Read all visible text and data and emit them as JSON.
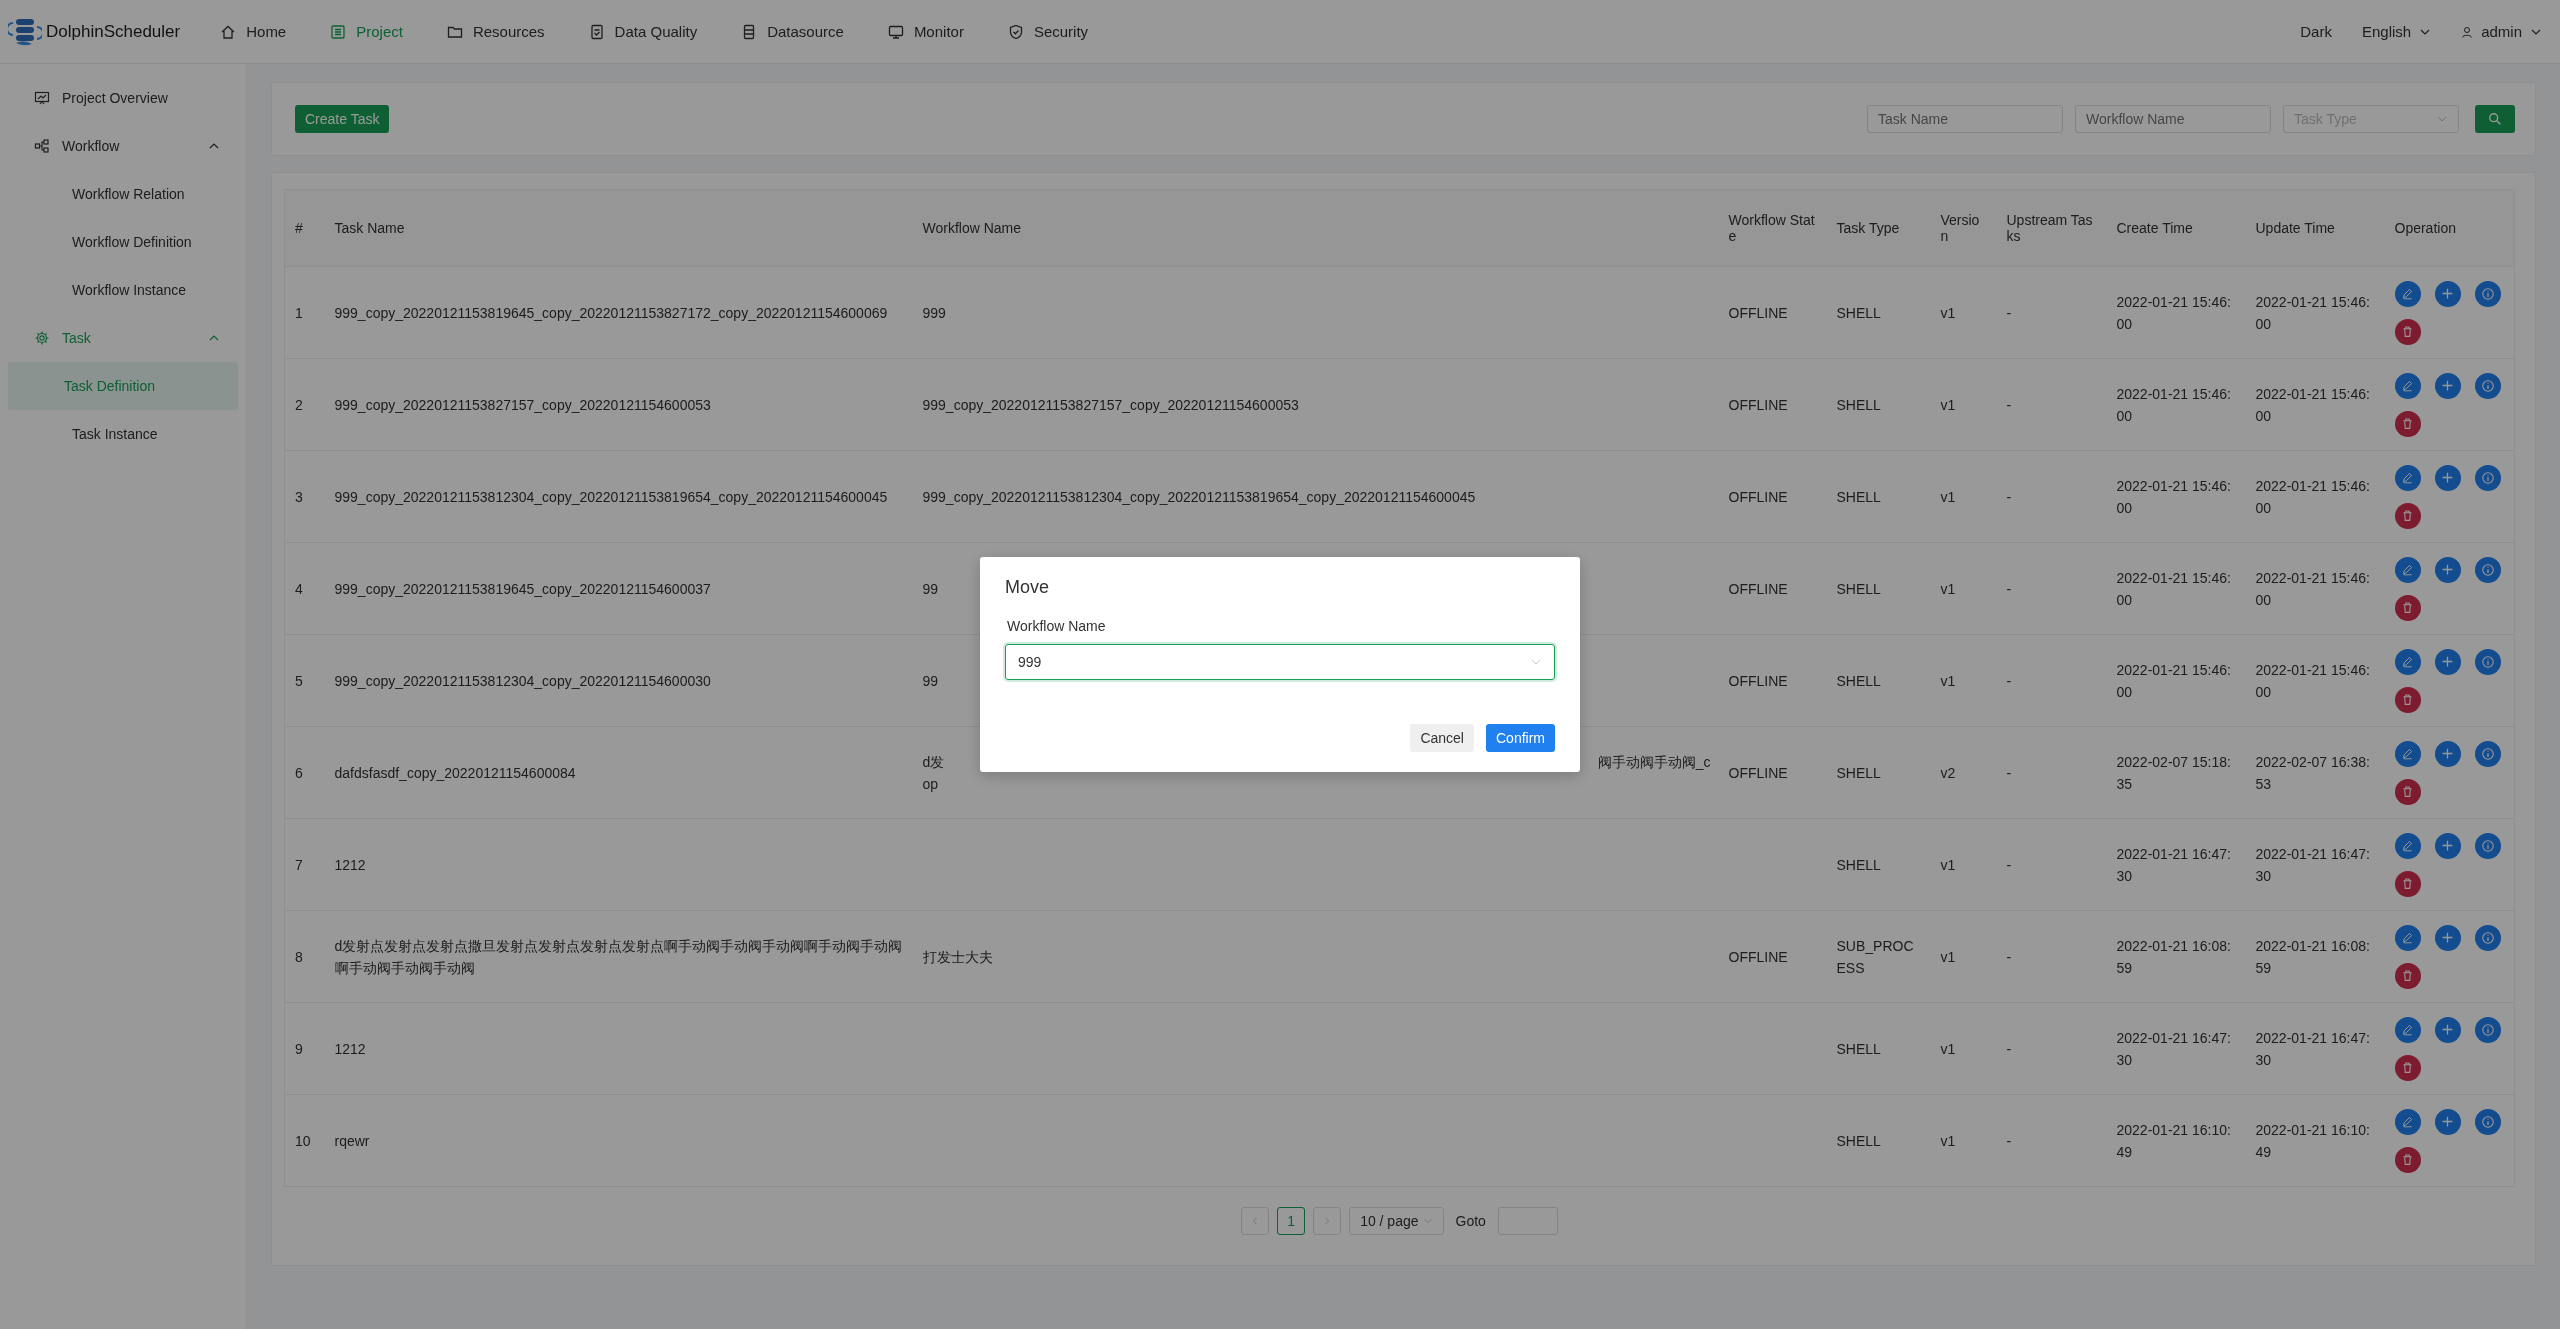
{
  "header": {
    "logo": "DolphinScheduler",
    "nav": [
      {
        "label": "Home",
        "kind": "home",
        "selected": false
      },
      {
        "label": "Project",
        "kind": "project",
        "selected": true
      },
      {
        "label": "Resources",
        "kind": "folder",
        "selected": false
      },
      {
        "label": "Data Quality",
        "kind": "quality",
        "selected": false
      },
      {
        "label": "Datasource",
        "kind": "datasource",
        "selected": false
      },
      {
        "label": "Monitor",
        "kind": "monitor",
        "selected": false
      },
      {
        "label": "Security",
        "kind": "shield",
        "selected": false
      }
    ],
    "theme": "Dark",
    "language": "English",
    "user": "admin"
  },
  "sidebar": {
    "items": [
      {
        "label": "Project Overview",
        "kind": "overview",
        "selected": false
      },
      {
        "label": "Workflow",
        "kind": "workflow",
        "expanded": true,
        "selected": false,
        "children": [
          {
            "label": "Workflow Relation",
            "selected": false
          },
          {
            "label": "Workflow Definition",
            "selected": false
          },
          {
            "label": "Workflow Instance",
            "selected": false
          }
        ]
      },
      {
        "label": "Task",
        "kind": "gear",
        "expanded": true,
        "selected": true,
        "children": [
          {
            "label": "Task Definition",
            "selected": true
          },
          {
            "label": "Task Instance",
            "selected": false
          }
        ]
      }
    ]
  },
  "toolbar": {
    "create_button": "Create Task",
    "filters": [
      {
        "kind": "input",
        "placeholder": "Task Name"
      },
      {
        "kind": "input",
        "placeholder": "Workflow Name"
      },
      {
        "kind": "select",
        "placeholder": "Task Type"
      }
    ]
  },
  "table": {
    "columns": [
      "#",
      "Task Name",
      "Workflow Name",
      "Workflow State",
      "Task Type",
      "Version",
      "Upstream Tasks",
      "Create Time",
      "Update Time",
      "Operation"
    ],
    "rows": [
      {
        "index": "1",
        "task_name": "999_copy_20220121153819645_copy_20220121153827172_copy_20220121154600069",
        "workflow_name": "999",
        "state": "OFFLINE",
        "task_type": "SHELL",
        "version": "v1",
        "upstream": "-",
        "create_time": "2022-01-21 15:46:00",
        "update_time": "2022-01-21 15:46:00"
      },
      {
        "index": "2",
        "task_name": "999_copy_20220121153827157_copy_20220121154600053",
        "workflow_name": "999_copy_20220121153827157_copy_20220121154600053",
        "state": "OFFLINE",
        "task_type": "SHELL",
        "version": "v1",
        "upstream": "-",
        "create_time": "2022-01-21 15:46:00",
        "update_time": "2022-01-21 15:46:00"
      },
      {
        "index": "3",
        "task_name": "999_copy_20220121153812304_copy_20220121153819654_copy_20220121154600045",
        "workflow_name": "999_copy_20220121153812304_copy_20220121153819654_copy_20220121154600045",
        "state": "OFFLINE",
        "task_type": "SHELL",
        "version": "v1",
        "upstream": "-",
        "create_time": "2022-01-21 15:46:00",
        "update_time": "2022-01-21 15:46:00"
      },
      {
        "index": "4",
        "task_name": "999_copy_20220121153819645_copy_20220121154600037",
        "workflow_name": "99",
        "state": "OFFLINE",
        "task_type": "SHELL",
        "version": "v1",
        "upstream": "-",
        "create_time": "2022-01-21 15:46:00",
        "update_time": "2022-01-21 15:46:00"
      },
      {
        "index": "5",
        "task_name": "999_copy_20220121153812304_copy_20220121154600030",
        "workflow_name": "99",
        "state": "OFFLINE",
        "task_type": "SHELL",
        "version": "v1",
        "upstream": "-",
        "create_time": "2022-01-21 15:46:00",
        "update_time": "2022-01-21 15:46:00"
      },
      {
        "index": "6",
        "task_name": "dafdsfasdf_copy_20220121154600084",
        "workflow_name_parts": {
          "start": [
            "d发",
            "op"
          ],
          "end": "阀手动阀手动阀_c"
        },
        "state": "OFFLINE",
        "task_type": "SHELL",
        "version": "v2",
        "upstream": "-",
        "create_time": "2022-02-07 15:18:35",
        "update_time": "2022-02-07 16:38:53"
      },
      {
        "index": "7",
        "task_name": "1212",
        "task_type": "SHELL",
        "version": "v1",
        "upstream": "-",
        "create_time": "2022-01-21 16:47:30",
        "update_time": "2022-01-21 16:47:30"
      },
      {
        "index": "8",
        "task_name": "d发射点发射点发射点撒旦发射点发射点发射点发射点啊手动阀手动阀手动阀啊手动阀手动阀啊手动阀手动阀手动阀",
        "workflow_name": "打发士大夫",
        "state": "OFFLINE",
        "task_type": "SUB_PROCESS",
        "version": "v1",
        "upstream": "-",
        "create_time": "2022-01-21 16:08:59",
        "update_time": "2022-01-21 16:08:59"
      },
      {
        "index": "9",
        "task_name": "1212",
        "task_type": "SHELL",
        "version": "v1",
        "upstream": "-",
        "create_time": "2022-01-21 16:47:30",
        "update_time": "2022-01-21 16:47:30"
      },
      {
        "index": "10",
        "task_name": "rqewr",
        "task_type": "SHELL",
        "version": "v1",
        "upstream": "-",
        "create_time": "2022-01-21 16:10:49",
        "update_time": "2022-01-21 16:10:49"
      }
    ]
  },
  "pagination": {
    "pages": [
      {
        "label": "1",
        "selected": true
      }
    ],
    "page_size": "10 / page",
    "goto_label": "Goto"
  },
  "modal": {
    "title": "Move",
    "field_label": "Workflow Name",
    "field_value": "999",
    "buttons": [
      {
        "label": "Cancel",
        "kind": "secondary"
      },
      {
        "label": "Confirm",
        "kind": "primary"
      }
    ]
  }
}
